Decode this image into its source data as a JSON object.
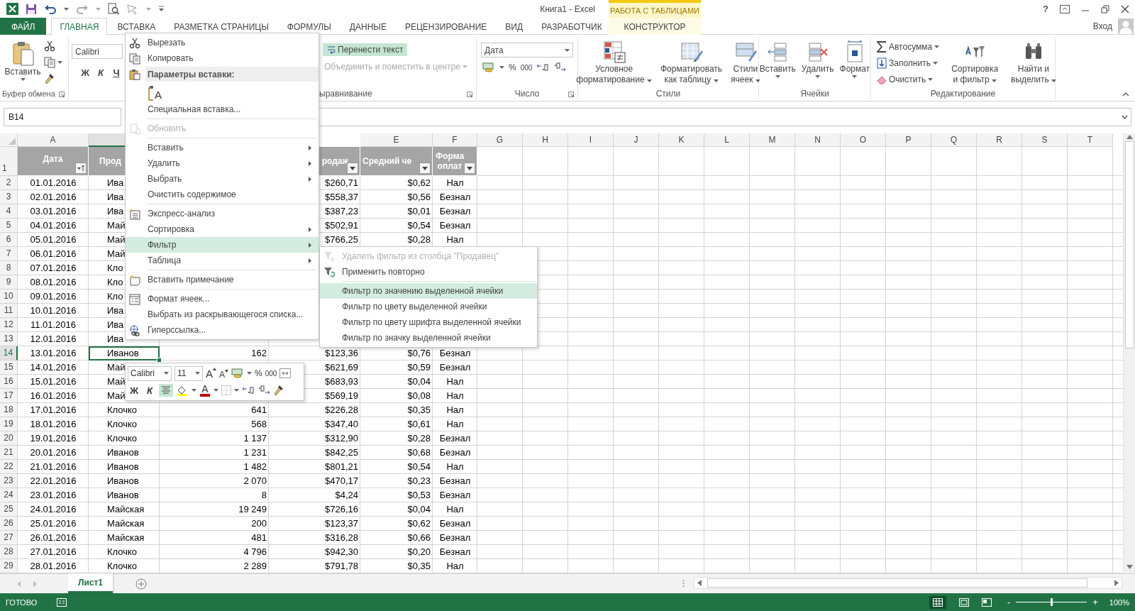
{
  "title_bar": {
    "title": "Книга1 - Excel",
    "context_group": "РАБОТА С ТАБЛИЦАМИ",
    "help": "?"
  },
  "ribbon_tabs": [
    {
      "label": "ФАЙЛ",
      "kind": "file",
      "selected": false
    },
    {
      "label": "ГЛАВНАЯ",
      "kind": "tab",
      "selected": true
    },
    {
      "label": "ВСТАВКА",
      "kind": "tab",
      "selected": false
    },
    {
      "label": "РАЗМЕТКА СТРАНИЦЫ",
      "kind": "tab",
      "selected": false
    },
    {
      "label": "ФОРМУЛЫ",
      "kind": "tab",
      "selected": false
    },
    {
      "label": "ДАННЫЕ",
      "kind": "tab",
      "selected": false
    },
    {
      "label": "РЕЦЕНЗИРОВАНИЕ",
      "kind": "tab",
      "selected": false
    },
    {
      "label": "ВИД",
      "kind": "tab",
      "selected": false
    },
    {
      "label": "РАЗРАБОТЧИК",
      "kind": "tab",
      "selected": false
    },
    {
      "label": "КОНСТРУКТОР",
      "kind": "context",
      "selected": false
    }
  ],
  "account": {
    "label": "Вход"
  },
  "ribbon": {
    "clipboard": {
      "label": "Буфер обмена",
      "paste": "Вставить"
    },
    "font": {
      "font_name": "Calibri",
      "bold": "Ж",
      "italic": "К",
      "underline": "Ч"
    },
    "alignment": {
      "label": "ыравнивание",
      "wrap_text": {
        "label": "Перенести текст",
        "on": true
      },
      "merge": {
        "label": "Объединить и поместить в центре",
        "disabled": true
      }
    },
    "number": {
      "label": "Число",
      "format": "Дата",
      "percent": "%",
      "thousands": "000"
    },
    "styles": {
      "label": "Стили",
      "buttons": [
        {
          "lines": [
            "Условное",
            "форматирование"
          ]
        },
        {
          "lines": [
            "Форматировать",
            "как таблицу"
          ]
        },
        {
          "lines": [
            "Стили",
            "ячеек"
          ]
        }
      ]
    },
    "cells": {
      "label": "Ячейки",
      "buttons": [
        "Вставить",
        "Удалить",
        "Формат"
      ]
    },
    "editing": {
      "label": "Редактирование",
      "commands": [
        "Автосумма",
        "Заполнить",
        "Очистить"
      ],
      "buttons": [
        {
          "lines": [
            "Сортировка",
            "и фильтр"
          ]
        },
        {
          "lines": [
            "Найти и",
            "выделить"
          ]
        }
      ]
    }
  },
  "formula_bar": {
    "name_box": "B14"
  },
  "sheet": {
    "columns": {
      "a": {
        "letter": "A",
        "selected": false
      },
      "b": {
        "selected": true
      },
      "e": {
        "letter": "E",
        "selected": false
      },
      "f": {
        "letter": "F",
        "selected": false
      },
      "g": {
        "letter": "G",
        "selected": false
      },
      "h": {
        "letter": "H",
        "selected": false
      },
      "i": {
        "letter": "I",
        "selected": false
      },
      "j": {
        "letter": "J",
        "selected": false
      },
      "k": {
        "letter": "K",
        "selected": false
      },
      "l": {
        "letter": "L",
        "selected": false
      },
      "m": {
        "letter": "M",
        "selected": false
      },
      "n": {
        "letter": "N",
        "selected": false
      },
      "o": {
        "letter": "O",
        "selected": false
      },
      "p": {
        "letter": "P",
        "selected": false
      },
      "q": {
        "letter": "Q",
        "selected": false
      },
      "r": {
        "letter": "R",
        "selected": false
      },
      "s": {
        "letter": "S",
        "selected": false
      },
      "t": {
        "letter": "T",
        "selected": false
      }
    },
    "header_row": {
      "number": "1",
      "a": {
        "label": "Дата",
        "filter_button": true,
        "sorted": true
      },
      "b": {
        "label": "Прод"
      },
      "d": {
        "label": "родаж",
        "filter_button": true,
        "sorted": false
      },
      "e": {
        "label": "Средний че",
        "filter_button": true,
        "sorted": false
      },
      "f": {
        "label": "Форма оплат",
        "filter_button": true,
        "sorted": false
      }
    },
    "rows": [
      {
        "number": "2",
        "selected": false,
        "a": "01.01.2016",
        "b": "Ива",
        "d": "$260,71",
        "e": "$0,62",
        "f": "Нал"
      },
      {
        "number": "3",
        "selected": false,
        "a": "02.01.2016",
        "b": "Ива",
        "d": "$558,37",
        "e": "$0,56",
        "f": "Безнал"
      },
      {
        "number": "4",
        "selected": false,
        "a": "03.01.2016",
        "b": "Ива",
        "d": "$387,23",
        "e": "$0,01",
        "f": "Безнал"
      },
      {
        "number": "5",
        "selected": false,
        "a": "04.01.2016",
        "b": "Май",
        "d": "$502,91",
        "e": "$0,54",
        "f": "Безнал"
      },
      {
        "number": "6",
        "selected": false,
        "a": "05.01.2016",
        "b": "Май",
        "d": "$766,25",
        "e": "$0,28",
        "f": "Нал"
      },
      {
        "number": "7",
        "selected": false,
        "a": "06.01.2016",
        "b": "Май"
      },
      {
        "number": "8",
        "selected": false,
        "a": "07.01.2016",
        "b": "Кло"
      },
      {
        "number": "9",
        "selected": false,
        "a": "08.01.2016",
        "b": "Кло"
      },
      {
        "number": "10",
        "selected": false,
        "a": "09.01.2016",
        "b": "Кло"
      },
      {
        "number": "11",
        "selected": false,
        "a": "10.01.2016",
        "b": "Ива"
      },
      {
        "number": "12",
        "selected": false,
        "a": "11.01.2016",
        "b": "Ива"
      },
      {
        "number": "13",
        "selected": false,
        "a": "12.01.2016",
        "b": "Ива"
      },
      {
        "number": "14",
        "selected": true,
        "a": "13.01.2016",
        "b": "Иванов",
        "c": "162",
        "d": "$123,36",
        "e": "$0,76",
        "f": "Безнал"
      },
      {
        "number": "15",
        "selected": false,
        "a": "14.01.2016",
        "b": "Май",
        "d": "$621,69",
        "e": "$0,59",
        "f": "Безнал"
      },
      {
        "number": "16",
        "selected": false,
        "a": "15.01.2016",
        "b": "Май",
        "d": "$683,93",
        "e": "$0,04",
        "f": "Нал"
      },
      {
        "number": "17",
        "selected": false,
        "a": "16.01.2016",
        "b": "Май",
        "d": "$569,19",
        "e": "$0,08",
        "f": "Нал"
      },
      {
        "number": "18",
        "selected": false,
        "a": "17.01.2016",
        "b": "Клочко",
        "c": "641",
        "d": "$226,28",
        "e": "$0,35",
        "f": "Нал"
      },
      {
        "number": "19",
        "selected": false,
        "a": "18.01.2016",
        "b": "Клочко",
        "c": "568",
        "d": "$347,40",
        "e": "$0,61",
        "f": "Нал"
      },
      {
        "number": "20",
        "selected": false,
        "a": "19.01.2016",
        "b": "Клочко",
        "c": "1 137",
        "d": "$312,90",
        "e": "$0,28",
        "f": "Безнал"
      },
      {
        "number": "21",
        "selected": false,
        "a": "20.01.2016",
        "b": "Иванов",
        "c": "1 231",
        "d": "$842,25",
        "e": "$0,68",
        "f": "Безнал"
      },
      {
        "number": "22",
        "selected": false,
        "a": "21.01.2016",
        "b": "Иванов",
        "c": "1 482",
        "d": "$801,21",
        "e": "$0,54",
        "f": "Нал"
      },
      {
        "number": "23",
        "selected": false,
        "a": "22.01.2016",
        "b": "Иванов",
        "c": "2 070",
        "d": "$470,17",
        "e": "$0,23",
        "f": "Безнал"
      },
      {
        "number": "24",
        "selected": false,
        "a": "23.01.2016",
        "b": "Иванов",
        "c": "8",
        "d": "$4,24",
        "e": "$0,53",
        "f": "Безнал"
      },
      {
        "number": "25",
        "selected": false,
        "a": "24.01.2016",
        "b": "Майская",
        "c": "19 249",
        "d": "$726,16",
        "e": "$0,04",
        "f": "Нал"
      },
      {
        "number": "26",
        "selected": false,
        "a": "25.01.2016",
        "b": "Майская",
        "c": "200",
        "d": "$123,37",
        "e": "$0,62",
        "f": "Безнал"
      },
      {
        "number": "27",
        "selected": false,
        "a": "26.01.2016",
        "b": "Майская",
        "c": "481",
        "d": "$316,28",
        "e": "$0,66",
        "f": "Безнал"
      },
      {
        "number": "28",
        "selected": false,
        "a": "27.01.2016",
        "b": "Клочко",
        "c": "4 796",
        "d": "$942,30",
        "e": "$0,20",
        "f": "Безнал"
      },
      {
        "number": "29",
        "selected": false,
        "a": "28.01.2016",
        "b": "Клочко",
        "c": "2 289",
        "d": "$791,78",
        "e": "$0,35",
        "f": "Нал"
      }
    ]
  },
  "context_menu": {
    "sections": [
      {
        "items": [
          {
            "kind": "command",
            "label": "Вырезать",
            "submenu": false,
            "disabled": false,
            "selected": false
          },
          {
            "kind": "command",
            "label": "Копировать",
            "submenu": false,
            "disabled": false,
            "selected": false
          },
          {
            "kind": "heading",
            "label": "Параметры вставки:"
          },
          {
            "kind": "paste_option",
            "glyph": "A"
          },
          {
            "kind": "command",
            "label": "Специальная вставка...",
            "submenu": false,
            "disabled": false,
            "selected": false
          }
        ]
      },
      {
        "items": [
          {
            "kind": "command",
            "label": "Обновить",
            "submenu": false,
            "disabled": true,
            "selected": false
          }
        ]
      },
      {
        "items": [
          {
            "kind": "command",
            "label": "Вставить",
            "submenu": true,
            "disabled": false,
            "selected": false
          },
          {
            "kind": "command",
            "label": "Удалить",
            "submenu": true,
            "disabled": false,
            "selected": false
          },
          {
            "kind": "command",
            "label": "Выбрать",
            "submenu": true,
            "disabled": false,
            "selected": false
          },
          {
            "kind": "command",
            "label": "Очистить содержимое",
            "submenu": false,
            "disabled": false,
            "selected": false
          }
        ]
      },
      {
        "items": [
          {
            "kind": "command",
            "label": "Экспресс-анализ",
            "submenu": false,
            "disabled": false,
            "selected": false
          },
          {
            "kind": "command",
            "label": "Сортировка",
            "submenu": true,
            "disabled": false,
            "selected": false
          },
          {
            "kind": "command",
            "label": "Фильтр",
            "submenu": true,
            "disabled": false,
            "selected": true
          },
          {
            "kind": "command",
            "label": "Таблица",
            "submenu": true,
            "disabled": false,
            "selected": false
          }
        ]
      },
      {
        "items": [
          {
            "kind": "command",
            "label": "Вставить примечание",
            "submenu": false,
            "disabled": false,
            "selected": false
          }
        ]
      },
      {
        "items": [
          {
            "kind": "command",
            "label": "Формат ячеек...",
            "submenu": false,
            "disabled": false,
            "selected": false
          },
          {
            "kind": "command",
            "label": "Выбрать из раскрывающегося списка...",
            "submenu": false,
            "disabled": false,
            "selected": false
          },
          {
            "kind": "command",
            "label": "Гиперссылка...",
            "submenu": false,
            "disabled": false,
            "selected": false
          }
        ]
      }
    ],
    "submenu": {
      "sections": [
        {
          "items": [
            {
              "label": "Удалить фильтр из столбца \"Продавец\"",
              "disabled": true,
              "selected": false
            },
            {
              "label": "Применить повторно",
              "disabled": false,
              "selected": false
            }
          ]
        },
        {
          "items": [
            {
              "label": "Фильтр по значению выделенной ячейки",
              "disabled": false,
              "selected": true
            },
            {
              "label": "Фильтр по цвету выделенной ячейки",
              "disabled": false,
              "selected": false
            },
            {
              "label": "Фильтр по цвету шрифта выделенной ячейки",
              "disabled": false,
              "selected": false
            },
            {
              "label": "Фильтр по значку выделенной ячейки",
              "disabled": false,
              "selected": false
            }
          ]
        }
      ]
    }
  },
  "mini_toolbar": {
    "font_name": "Calibri",
    "font_size": "11",
    "grow_font": "A",
    "shrink_font": "A",
    "percent": "%",
    "thousands": "000",
    "bold": "Ж",
    "italic": "К",
    "center_align": {
      "on": true
    },
    "font_color": "A"
  },
  "sheet_tabs": [
    {
      "label": "Лист1",
      "selected": true
    }
  ],
  "status_bar": {
    "status": "ГОТОВО",
    "zoom": {
      "minus": "-",
      "level": 0.5,
      "plus": "+",
      "reading": "100%"
    }
  }
}
